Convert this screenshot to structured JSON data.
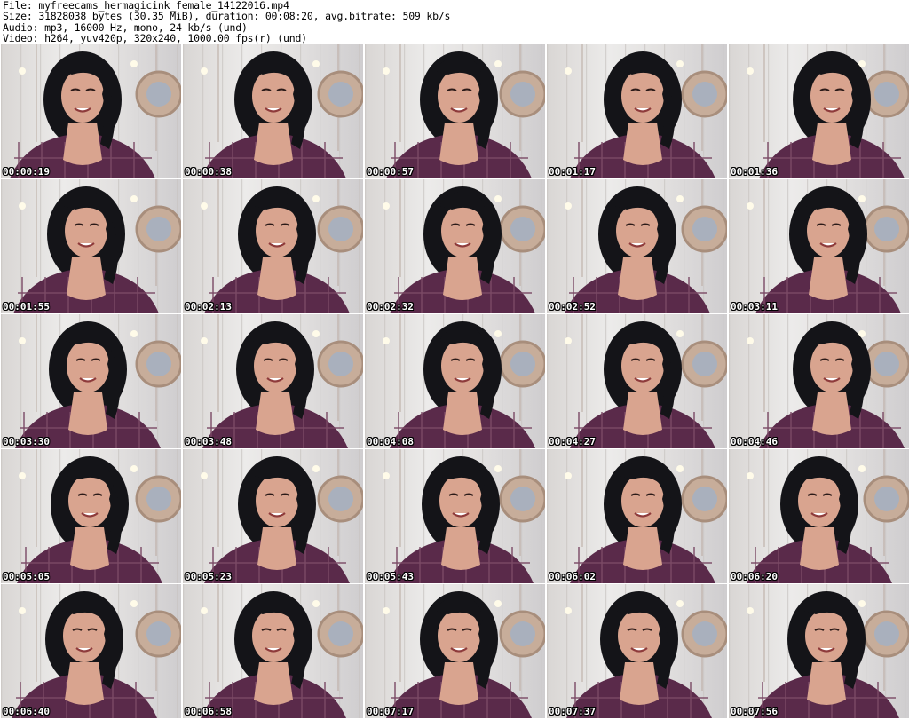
{
  "header": {
    "file": "File: myfreecams_hermagicink_female_14122016.mp4",
    "size": "Size: 31828038 bytes (30.35 MiB), duration: 00:08:20, avg.bitrate: 509 kb/s",
    "audio": "Audio: mp3, 16000 Hz, mono, 24 kb/s (und)",
    "video": "Video: h264, yuv420p, 320x240, 1000.00 fps(r) (und)"
  },
  "colors": {
    "wall": "#e8e6e5",
    "shirt": "#5a2a4a",
    "hair": "#141418",
    "skin": "#d9a48f"
  },
  "frames": [
    {
      "timestamp": "00:00:19"
    },
    {
      "timestamp": "00:00:38"
    },
    {
      "timestamp": "00:00:57"
    },
    {
      "timestamp": "00:01:17"
    },
    {
      "timestamp": "00:01:36"
    },
    {
      "timestamp": "00:01:55"
    },
    {
      "timestamp": "00:02:13"
    },
    {
      "timestamp": "00:02:32"
    },
    {
      "timestamp": "00:02:52"
    },
    {
      "timestamp": "00:03:11"
    },
    {
      "timestamp": "00:03:30"
    },
    {
      "timestamp": "00:03:48"
    },
    {
      "timestamp": "00:04:08"
    },
    {
      "timestamp": "00:04:27"
    },
    {
      "timestamp": "00:04:46"
    },
    {
      "timestamp": "00:05:05"
    },
    {
      "timestamp": "00:05:23"
    },
    {
      "timestamp": "00:05:43"
    },
    {
      "timestamp": "00:06:02"
    },
    {
      "timestamp": "00:06:20"
    },
    {
      "timestamp": "00:06:40"
    },
    {
      "timestamp": "00:06:58"
    },
    {
      "timestamp": "00:07:17"
    },
    {
      "timestamp": "00:07:37"
    },
    {
      "timestamp": "00:07:56"
    }
  ]
}
